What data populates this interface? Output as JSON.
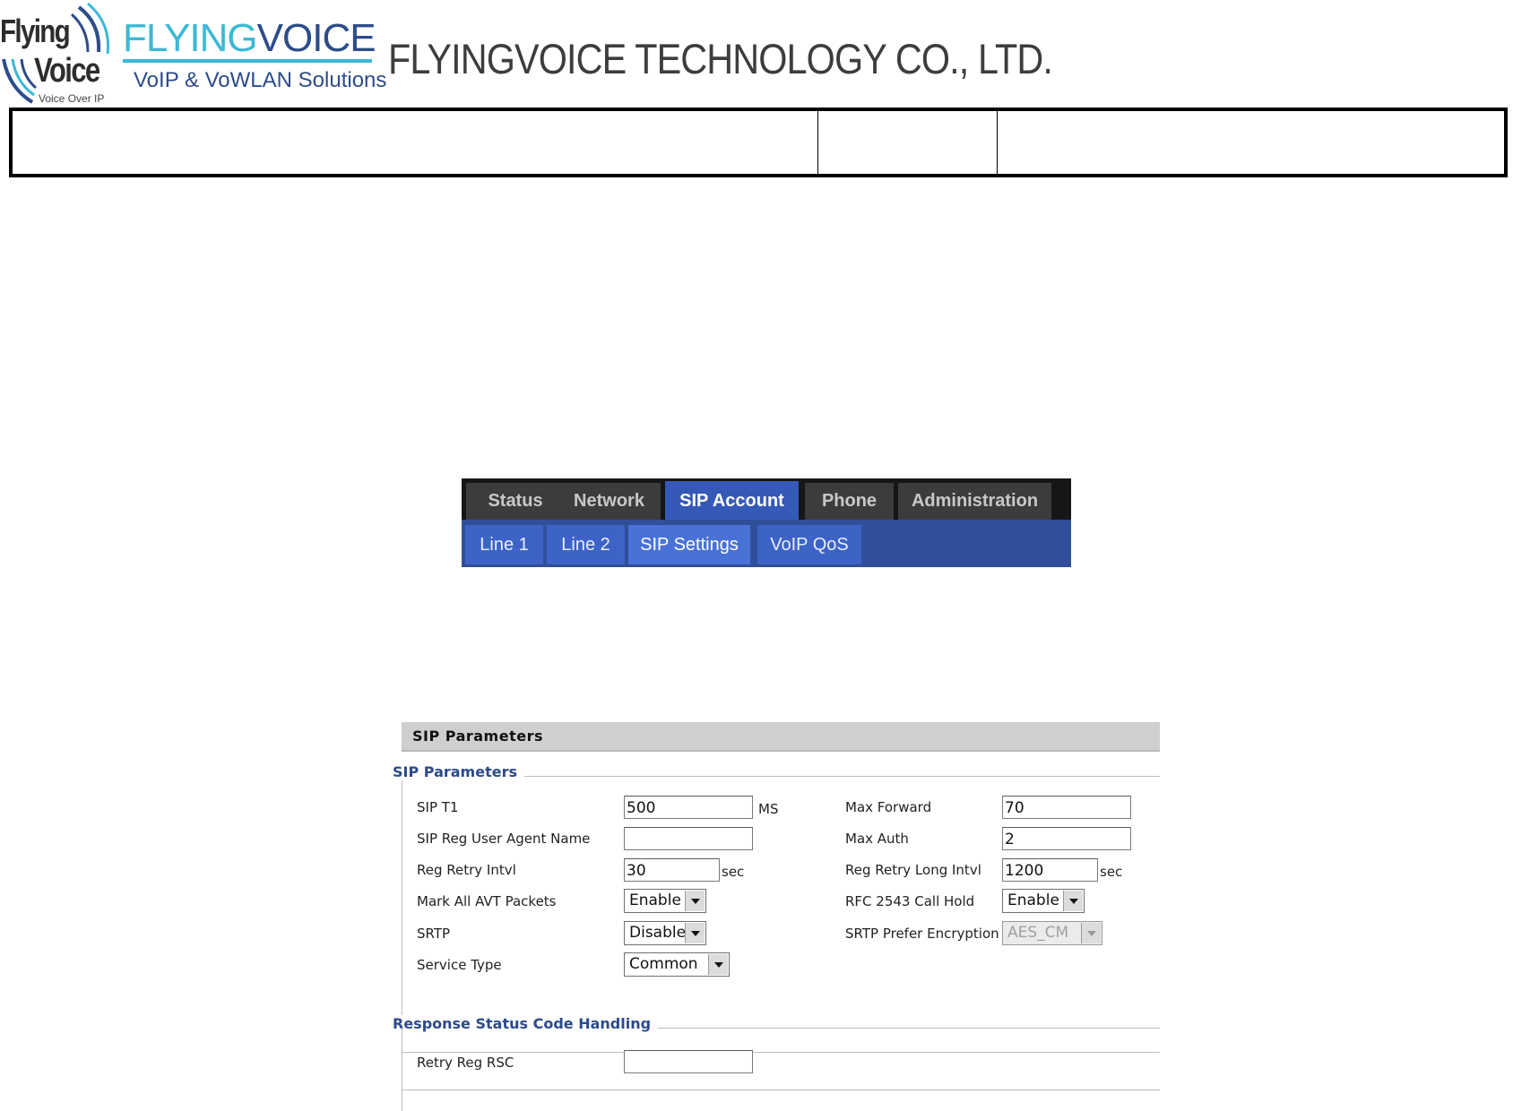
{
  "header": {
    "logo_left_line1": "Flying",
    "logo_left_line2": "Voice",
    "logo_left_tagline": "Voice Over IP",
    "brand_part1": "FLYING",
    "brand_part2": "VOICE",
    "brand_sub": "VoIP & VoWLAN Solutions",
    "company": "FLYINGVOICE TECHNOLOGY CO., LTD."
  },
  "nav": {
    "tabs": [
      "Status",
      "Network",
      "SIP Account",
      "Phone",
      "Administration"
    ],
    "active_tab": "SIP Account",
    "subtabs": [
      "Line 1",
      "Line 2",
      "SIP Settings",
      "VoIP QoS"
    ],
    "active_subtab": "SIP Settings"
  },
  "sip": {
    "title": "SIP Parameters",
    "section1_legend": "SIP Parameters",
    "section2_legend": "Response Status Code Handling",
    "fields": {
      "sip_t1": {
        "label": "SIP T1",
        "value": "500",
        "unit": "MS"
      },
      "user_agent": {
        "label": "SIP Reg User Agent Name",
        "value": ""
      },
      "reg_retry": {
        "label": "Reg Retry Intvl",
        "value": "30",
        "unit": "sec"
      },
      "mark_avt": {
        "label": "Mark All AVT Packets",
        "value": "Enable"
      },
      "srtp": {
        "label": "SRTP",
        "value": "Disable"
      },
      "service_type": {
        "label": "Service Type",
        "value": "Common"
      },
      "max_forward": {
        "label": "Max Forward",
        "value": "70"
      },
      "max_auth": {
        "label": "Max Auth",
        "value": "2"
      },
      "reg_retry_long": {
        "label": "Reg Retry Long Intvl",
        "value": "1200",
        "unit": "sec"
      },
      "rfc2543": {
        "label": "RFC 2543 Call Hold",
        "value": "Enable"
      },
      "srtp_enc": {
        "label": "SRTP Prefer Encryption",
        "value": "AES_CM"
      },
      "retry_reg_rsc": {
        "label": "Retry Reg RSC",
        "value": ""
      }
    }
  },
  "colors": {
    "brand_cyan": "#3bb9d6",
    "brand_navy": "#2d4c8a",
    "tab_active": "#3559b7",
    "legend_blue": "#2c4a8b"
  }
}
